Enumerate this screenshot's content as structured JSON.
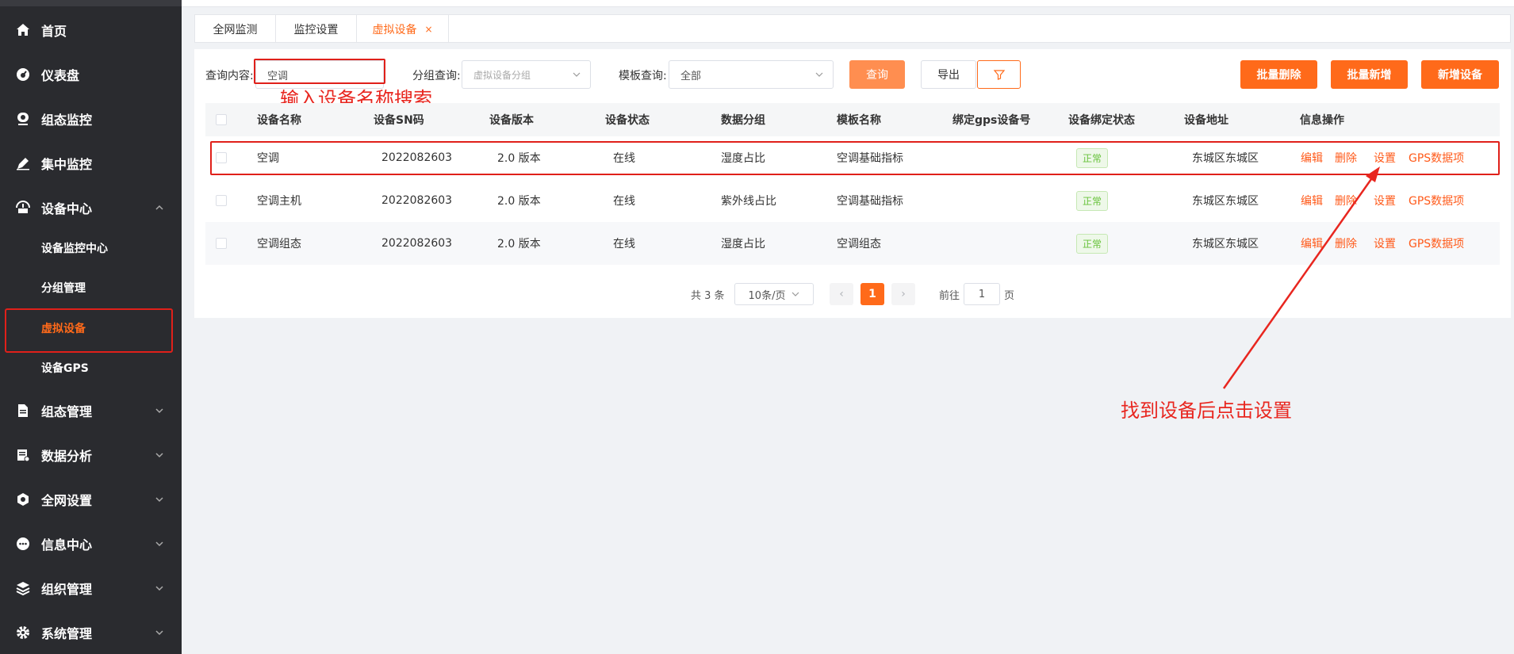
{
  "sidebar": {
    "items": [
      {
        "label": "首页",
        "icon": "home-icon"
      },
      {
        "label": "仪表盘",
        "icon": "dashboard-icon"
      },
      {
        "label": "组态监控",
        "icon": "monitor-icon"
      },
      {
        "label": "集中监控",
        "icon": "pen-icon"
      },
      {
        "label": "设备中心",
        "icon": "device-icon"
      },
      {
        "label": "组态管理",
        "icon": "document-icon"
      },
      {
        "label": "数据分析",
        "icon": "analysis-icon"
      },
      {
        "label": "全网设置",
        "icon": "settings-circle-icon"
      },
      {
        "label": "信息中心",
        "icon": "chat-icon"
      },
      {
        "label": "组织管理",
        "icon": "layers-icon"
      },
      {
        "label": "系统管理",
        "icon": "gear-icon"
      }
    ],
    "sub_items": [
      {
        "label": "设备监控中心"
      },
      {
        "label": "分组管理"
      },
      {
        "label": "虚拟设备"
      },
      {
        "label": "设备GPS"
      }
    ]
  },
  "tabs": [
    {
      "label": "全网监测"
    },
    {
      "label": "监控设置"
    },
    {
      "label": "虚拟设备",
      "close": "×"
    }
  ],
  "filters": {
    "query_label": "查询内容:",
    "query_value": "空调",
    "group_label": "分组查询:",
    "group_placeholder": "虚拟设备分组",
    "template_label": "模板查询:",
    "template_value": "全部",
    "search_button": "查询",
    "export_button": "导出"
  },
  "actions": {
    "batch_delete": "批量删除",
    "batch_add": "批量新增",
    "add_device": "新增设备"
  },
  "table": {
    "headers": [
      "设备名称",
      "设备SN码",
      "设备版本",
      "设备状态",
      "数据分组",
      "模板名称",
      "绑定gps设备号",
      "设备绑定状态",
      "设备地址",
      "信息操作"
    ],
    "rows": [
      {
        "name": "空调",
        "sn": "2022082603",
        "version": "2.0 版本",
        "status": "在线",
        "group": "湿度占比",
        "template": "空调基础指标",
        "gps": "",
        "bind_status": "正常",
        "address": "东城区东城区"
      },
      {
        "name": "空调主机",
        "sn": "2022082603",
        "version": "2.0 版本",
        "status": "在线",
        "group": "紫外线占比",
        "template": "空调基础指标",
        "gps": "",
        "bind_status": "正常",
        "address": "东城区东城区"
      },
      {
        "name": "空调组态",
        "sn": "2022082603",
        "version": "2.0 版本",
        "status": "在线",
        "group": "湿度占比",
        "template": "空调组态",
        "gps": "",
        "bind_status": "正常",
        "address": "东城区东城区"
      }
    ],
    "ops": {
      "edit": "编辑",
      "delete": "删除",
      "settings": "设置",
      "gps": "GPS数据项"
    }
  },
  "pagination": {
    "total": "共 3 条",
    "page_size": "10条/页",
    "prev": "‹",
    "current": "1",
    "next": "›",
    "goto_label": "前往",
    "goto_value": "1",
    "page_suffix": "页"
  },
  "annotations": {
    "search_hint": "输入设备名称搜索",
    "click_hint": "找到设备后点击设置"
  },
  "colors": {
    "accent": "#ff6a1a",
    "annotation_red": "#e0201a",
    "sidebar_bg": "#2a2b2f"
  }
}
